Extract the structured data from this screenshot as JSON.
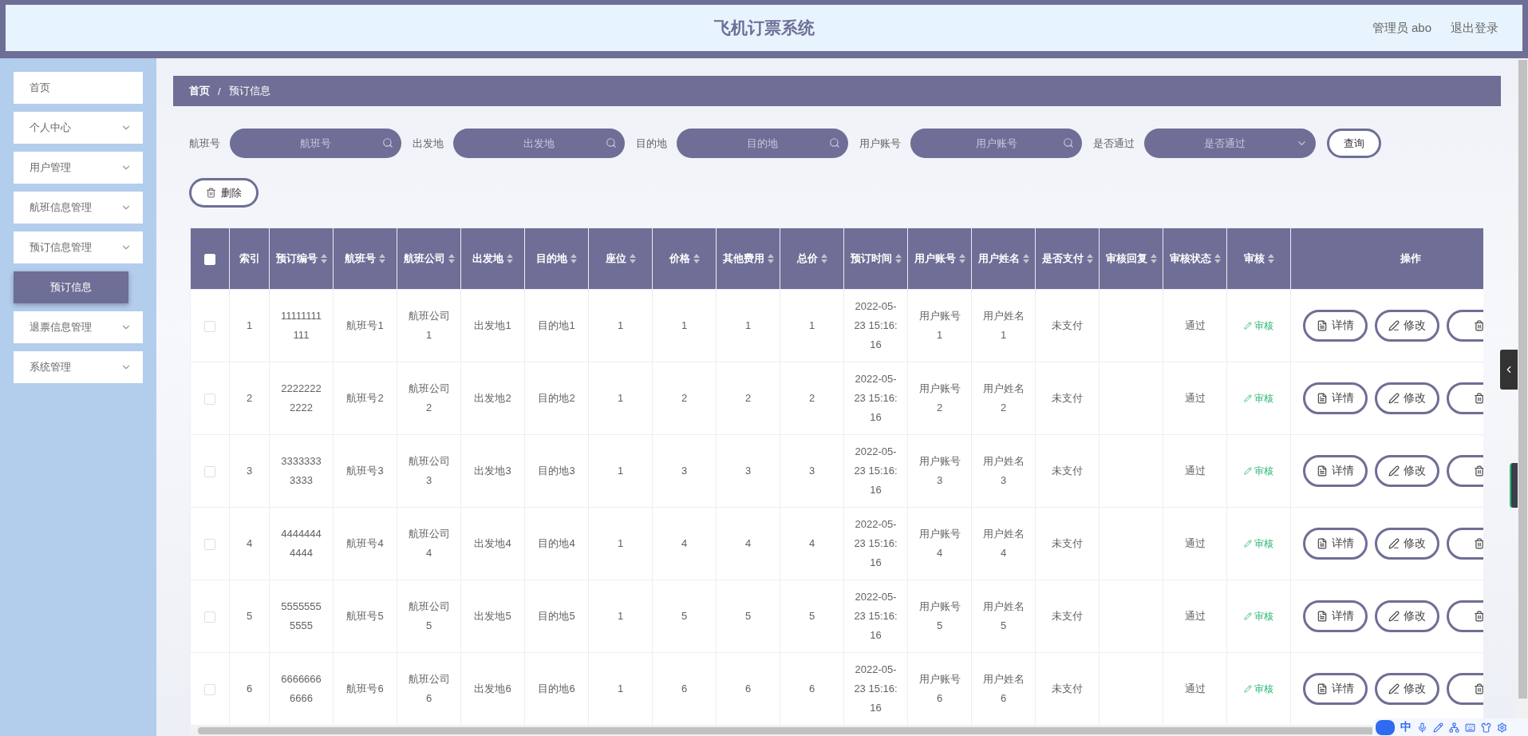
{
  "header": {
    "title": "飞机订票系统",
    "user": "管理员 abo",
    "logout": "退出登录"
  },
  "sidebar": {
    "items": [
      {
        "label": "首页",
        "kind": "item"
      },
      {
        "label": "个人中心",
        "kind": "submenu"
      },
      {
        "label": "用户管理",
        "kind": "submenu"
      },
      {
        "label": "航班信息管理",
        "kind": "submenu"
      },
      {
        "label": "预订信息管理",
        "kind": "submenu",
        "children": [
          {
            "label": "预订信息",
            "selected": true
          }
        ]
      },
      {
        "label": "退票信息管理",
        "kind": "submenu"
      },
      {
        "label": "系统管理",
        "kind": "submenu"
      }
    ]
  },
  "breadcrumb": [
    "首页",
    "/",
    "预订信息"
  ],
  "filters": [
    {
      "label": "航班号",
      "placeholder": "航班号",
      "kind": "input"
    },
    {
      "label": "出发地",
      "placeholder": "出发地",
      "kind": "input"
    },
    {
      "label": "目的地",
      "placeholder": "目的地",
      "kind": "input"
    },
    {
      "label": "用户账号",
      "placeholder": "用户账号",
      "kind": "input"
    },
    {
      "label": "是否通过",
      "placeholder": "是否通过",
      "kind": "select"
    }
  ],
  "query_button": "查询",
  "delete_button": "删除",
  "table": {
    "header_checked": false,
    "columns": [
      {
        "label": "索引",
        "sortable": false
      },
      {
        "label": "预订编号",
        "sortable": true
      },
      {
        "label": "航班号",
        "sortable": true
      },
      {
        "label": "航班公司",
        "sortable": true
      },
      {
        "label": "出发地",
        "sortable": true
      },
      {
        "label": "目的地",
        "sortable": true
      },
      {
        "label": "座位",
        "sortable": true
      },
      {
        "label": "价格",
        "sortable": true
      },
      {
        "label": "其他费用",
        "sortable": true
      },
      {
        "label": "总价",
        "sortable": true
      },
      {
        "label": "预订时间",
        "sortable": true
      },
      {
        "label": "用户账号",
        "sortable": true
      },
      {
        "label": "用户姓名",
        "sortable": true
      },
      {
        "label": "是否支付",
        "sortable": true
      },
      {
        "label": "审核回复",
        "sortable": true
      },
      {
        "label": "审核状态",
        "sortable": true
      },
      {
        "label": "审核",
        "sortable": true
      },
      {
        "label": "操作",
        "sortable": false
      }
    ],
    "rows": [
      {
        "checked": false,
        "cells": [
          "1",
          "11111111111",
          "航班号1",
          "航班公司1",
          "出发地1",
          "目的地1",
          "1",
          "1",
          "1",
          "1",
          "2022-05-23 15:16:16",
          "用户账号1",
          "用户姓名1",
          "未支付",
          "",
          "通过"
        ],
        "review": "审核",
        "actions": [
          {
            "kind": "detail",
            "label": "详情"
          },
          {
            "kind": "edit",
            "label": "修改"
          },
          {
            "kind": "delete"
          }
        ]
      },
      {
        "checked": false,
        "cells": [
          "2",
          "22222222222",
          "航班号2",
          "航班公司2",
          "出发地2",
          "目的地2",
          "1",
          "2",
          "2",
          "2",
          "2022-05-23 15:16:16",
          "用户账号2",
          "用户姓名2",
          "未支付",
          "",
          "通过"
        ],
        "review": "审核",
        "actions": [
          {
            "kind": "detail",
            "label": "详情"
          },
          {
            "kind": "edit",
            "label": "修改"
          },
          {
            "kind": "delete"
          }
        ]
      },
      {
        "checked": false,
        "cells": [
          "3",
          "33333333333",
          "航班号3",
          "航班公司3",
          "出发地3",
          "目的地3",
          "1",
          "3",
          "3",
          "3",
          "2022-05-23 15:16:16",
          "用户账号3",
          "用户姓名3",
          "未支付",
          "",
          "通过"
        ],
        "review": "审核",
        "actions": [
          {
            "kind": "detail",
            "label": "详情"
          },
          {
            "kind": "edit",
            "label": "修改"
          },
          {
            "kind": "delete"
          }
        ]
      },
      {
        "checked": false,
        "cells": [
          "4",
          "44444444444",
          "航班号4",
          "航班公司4",
          "出发地4",
          "目的地4",
          "1",
          "4",
          "4",
          "4",
          "2022-05-23 15:16:16",
          "用户账号4",
          "用户姓名4",
          "未支付",
          "",
          "通过"
        ],
        "review": "审核",
        "actions": [
          {
            "kind": "detail",
            "label": "详情"
          },
          {
            "kind": "edit",
            "label": "修改"
          },
          {
            "kind": "delete"
          }
        ]
      },
      {
        "checked": false,
        "cells": [
          "5",
          "55555555555",
          "航班号5",
          "航班公司5",
          "出发地5",
          "目的地5",
          "1",
          "5",
          "5",
          "5",
          "2022-05-23 15:16:16",
          "用户账号5",
          "用户姓名5",
          "未支付",
          "",
          "通过"
        ],
        "review": "审核",
        "actions": [
          {
            "kind": "detail",
            "label": "详情"
          },
          {
            "kind": "edit",
            "label": "修改"
          },
          {
            "kind": "delete"
          }
        ]
      },
      {
        "checked": false,
        "cells": [
          "6",
          "66666666666",
          "航班号6",
          "航班公司6",
          "出发地6",
          "目的地6",
          "1",
          "6",
          "6",
          "6",
          "2022-05-23 15:16:16",
          "用户账号6",
          "用户姓名6",
          "未支付",
          "",
          "通过"
        ],
        "review": "审核",
        "actions": [
          {
            "kind": "detail",
            "label": "详情"
          },
          {
            "kind": "edit",
            "label": "修改"
          },
          {
            "kind": "delete"
          }
        ]
      }
    ]
  },
  "ime": {
    "mode": "中"
  }
}
